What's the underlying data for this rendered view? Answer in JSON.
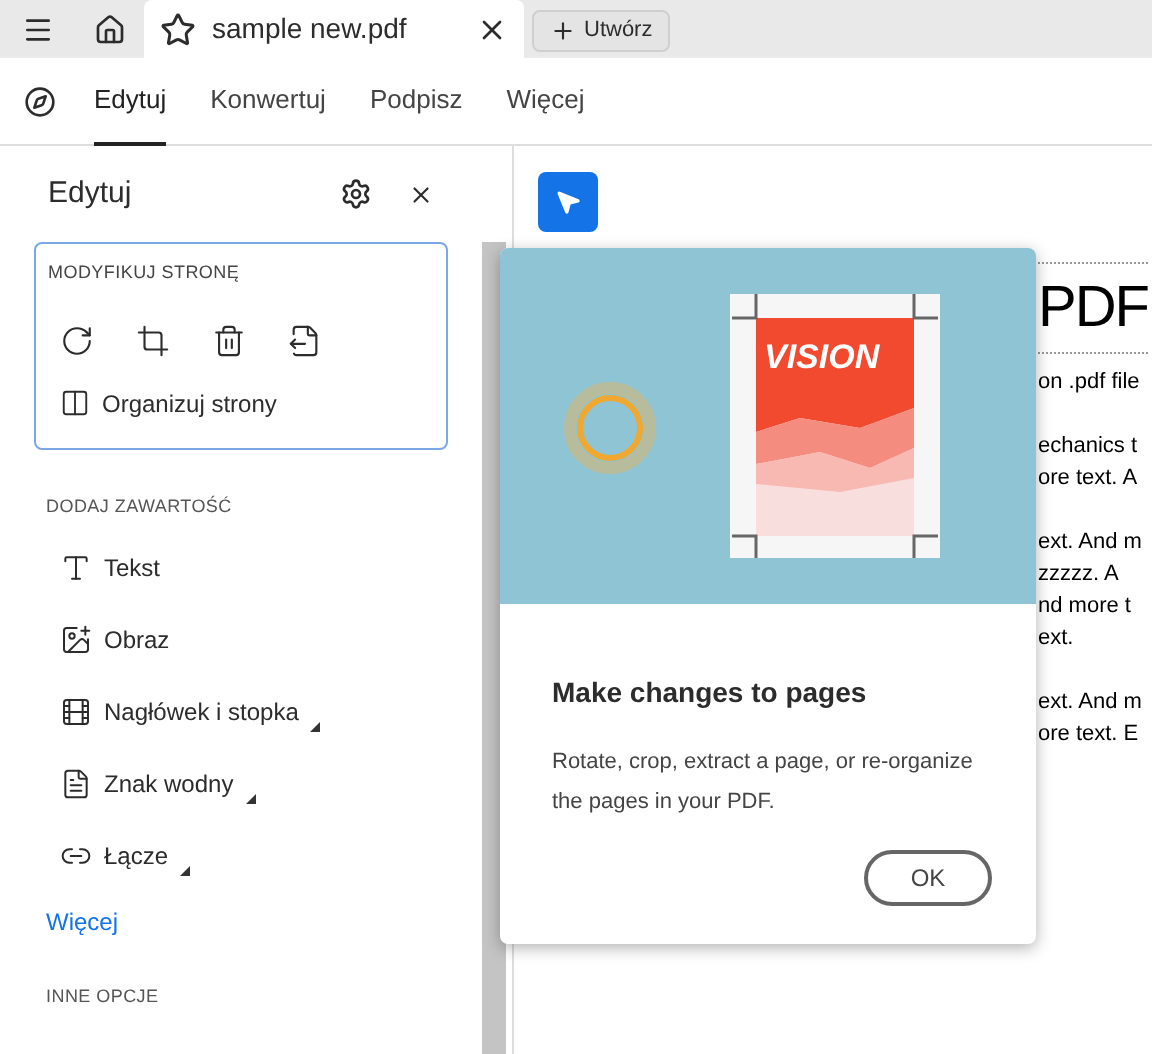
{
  "top_bar": {
    "tab": {
      "title": "sample new.pdf"
    },
    "create_button": "Utwórz"
  },
  "toolbar": {
    "tabs": [
      {
        "label": "Edytuj",
        "selected": true
      },
      {
        "label": "Konwertuj",
        "selected": false
      },
      {
        "label": "Podpisz",
        "selected": false
      },
      {
        "label": "Więcej",
        "selected": false
      }
    ]
  },
  "panel": {
    "title": "Edytuj",
    "modify_section": {
      "heading": "MODYFIKUJ STRONĘ",
      "tools": [
        {
          "kind": "rotate"
        },
        {
          "kind": "crop"
        },
        {
          "kind": "delete"
        },
        {
          "kind": "extract"
        }
      ],
      "organize": "Organizuj strony"
    },
    "add_section": {
      "heading": "DODAJ ZAWARTOŚĆ",
      "items": [
        {
          "kind": "text",
          "label": "Tekst",
          "submenu": false
        },
        {
          "kind": "image",
          "label": "Obraz",
          "submenu": false
        },
        {
          "kind": "header",
          "label": "Nagłówek i stopka",
          "submenu": true
        },
        {
          "kind": "watermark",
          "label": "Znak wodny",
          "submenu": true
        },
        {
          "kind": "link",
          "label": "Łącze",
          "submenu": true
        }
      ],
      "more_link": "Więcej"
    },
    "other_heading": "INNE OPCJE"
  },
  "document": {
    "heading": "PDF",
    "paragraphs": [
      [
        "on .pdf file"
      ],
      [
        "echanics t",
        "ore text. A"
      ],
      [
        "ext. And m",
        "zzzzz. A",
        "nd more t",
        "ext."
      ],
      [
        "ext. And m",
        "ore text. E"
      ]
    ]
  },
  "popup": {
    "illustration_text": "VISION",
    "title": "Make changes to pages",
    "body": "Rotate, crop, extract a page, or re-organize the pages in your PDF.",
    "button": "OK"
  }
}
